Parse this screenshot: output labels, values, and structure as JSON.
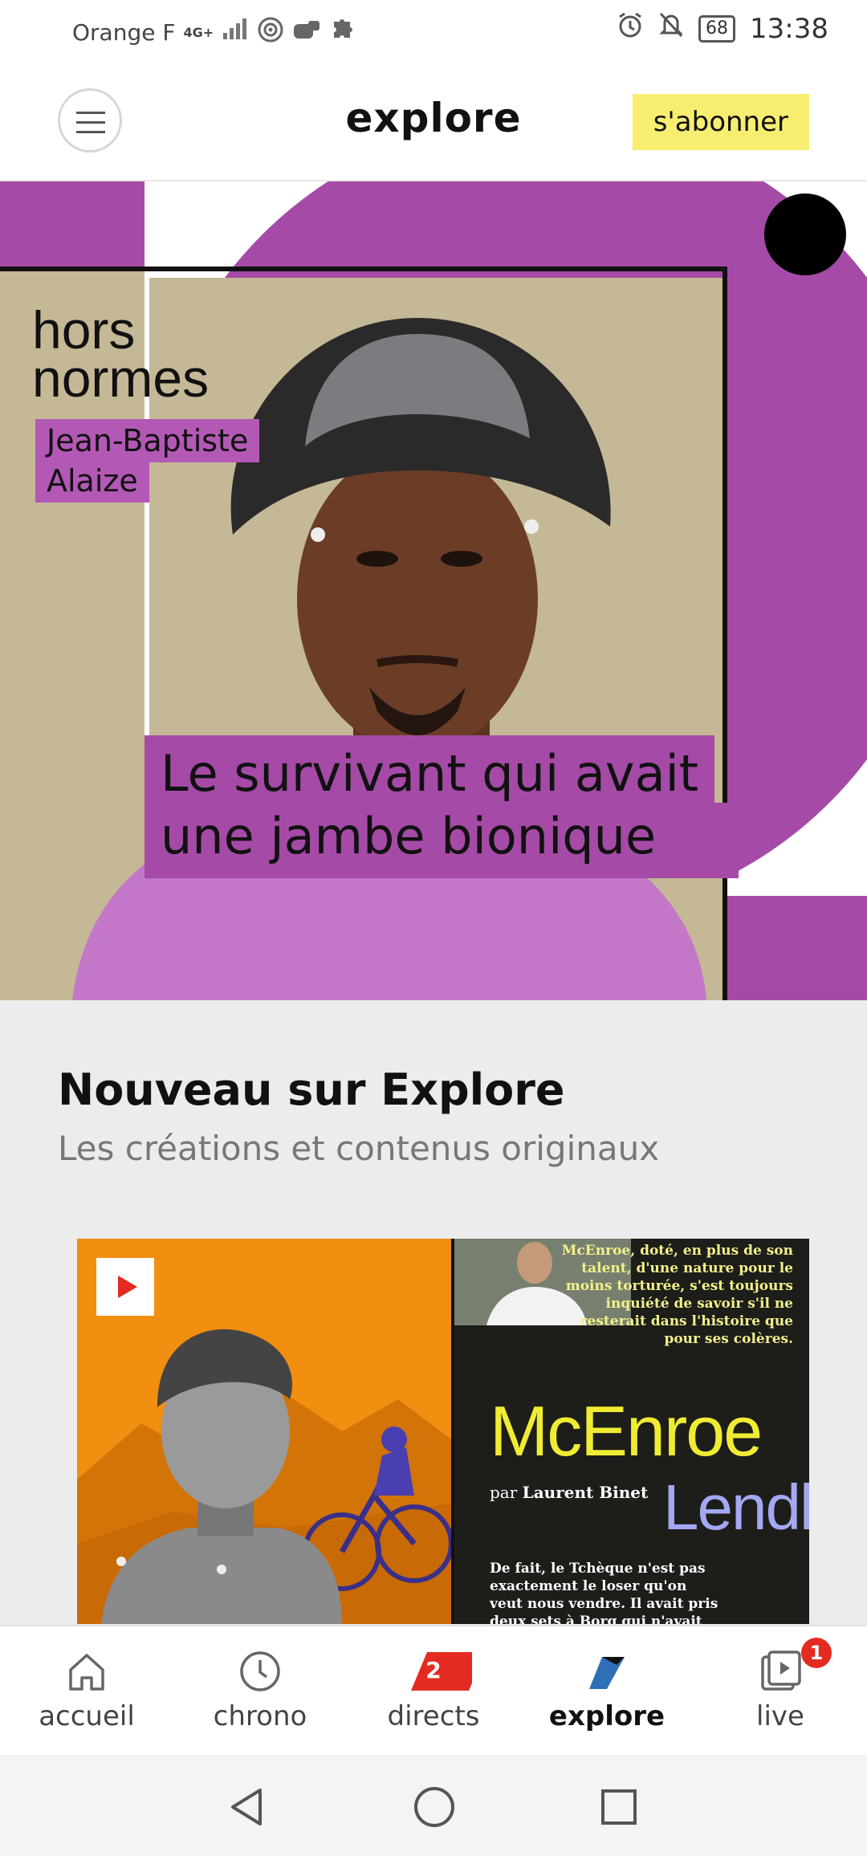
{
  "status_bar": {
    "carrier": "Orange F",
    "network": "4G+",
    "battery": "68",
    "time": "13:38"
  },
  "header": {
    "title": "explore",
    "subscribe_label": "s'abonner"
  },
  "hero": {
    "series": "hors normes",
    "person_line1": "Jean-Baptiste",
    "person_line2": "Alaize",
    "headline_line1": "Le survivant qui avait",
    "headline_line2": "une jambe bionique"
  },
  "section": {
    "title": "Nouveau sur Explore",
    "subtitle": "Les créations et contenus originaux"
  },
  "card": {
    "quote": "McEnroe, doté, en plus de son talent, d'une nature pour le moins torturée, s'est toujours inquiété de savoir s'il ne resterait dans l'histoire que pour ses colères.",
    "name1": "McEnroe",
    "name2": "Lendl",
    "byline_prefix": "par",
    "byline_author": "Laurent Binet",
    "teaser": "De fait, le Tchèque n'est pas exactement le loser qu'on veut nous vendre. Il avait pris deux sets à Borg qui n'avait"
  },
  "bottom_nav": [
    {
      "label": "accueil",
      "icon": "home-icon"
    },
    {
      "label": "chrono",
      "icon": "clock-icon"
    },
    {
      "label": "directs",
      "icon": "directs-icon",
      "badge": "2"
    },
    {
      "label": "explore",
      "icon": "explore-icon"
    },
    {
      "label": "live",
      "icon": "live-icon",
      "badge": "1"
    }
  ],
  "colors": {
    "accent_yellow": "#f7ee71",
    "hero_purple": "#a54aa6",
    "badge_red": "#e32b21",
    "card_orange": "#f28e10"
  }
}
